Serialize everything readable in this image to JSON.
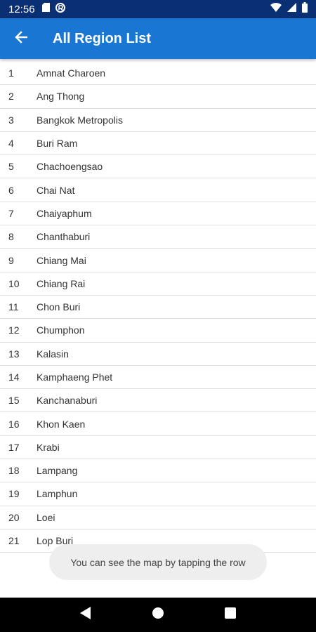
{
  "status": {
    "time": "12:56",
    "left_icons": [
      "sd-card-icon",
      "vpn-icon"
    ],
    "right_icons": [
      "wifi-icon",
      "signal-icon",
      "battery-icon"
    ]
  },
  "app_bar": {
    "title": "All Region List",
    "background": "#1976d2"
  },
  "regions": [
    {
      "num": "1",
      "name": "Amnat Charoen"
    },
    {
      "num": "2",
      "name": "Ang Thong"
    },
    {
      "num": "3",
      "name": "Bangkok Metropolis"
    },
    {
      "num": "4",
      "name": "Buri Ram"
    },
    {
      "num": "5",
      "name": "Chachoengsao"
    },
    {
      "num": "6",
      "name": "Chai Nat"
    },
    {
      "num": "7",
      "name": "Chaiyaphum"
    },
    {
      "num": "8",
      "name": "Chanthaburi"
    },
    {
      "num": "9",
      "name": "Chiang Mai"
    },
    {
      "num": "10",
      "name": "Chiang Rai"
    },
    {
      "num": "11",
      "name": "Chon Buri"
    },
    {
      "num": "12",
      "name": "Chumphon"
    },
    {
      "num": "13",
      "name": "Kalasin"
    },
    {
      "num": "14",
      "name": "Kamphaeng Phet"
    },
    {
      "num": "15",
      "name": "Kanchanaburi"
    },
    {
      "num": "16",
      "name": "Khon Kaen"
    },
    {
      "num": "17",
      "name": "Krabi"
    },
    {
      "num": "18",
      "name": "Lampang"
    },
    {
      "num": "19",
      "name": "Lamphun"
    },
    {
      "num": "20",
      "name": "Loei"
    },
    {
      "num": "21",
      "name": "Lop Buri"
    }
  ],
  "toast": {
    "message": "You can see the map by tapping the row"
  },
  "nav": {
    "icons": [
      "back-triangle-icon",
      "home-circle-icon",
      "recents-square-icon"
    ]
  }
}
